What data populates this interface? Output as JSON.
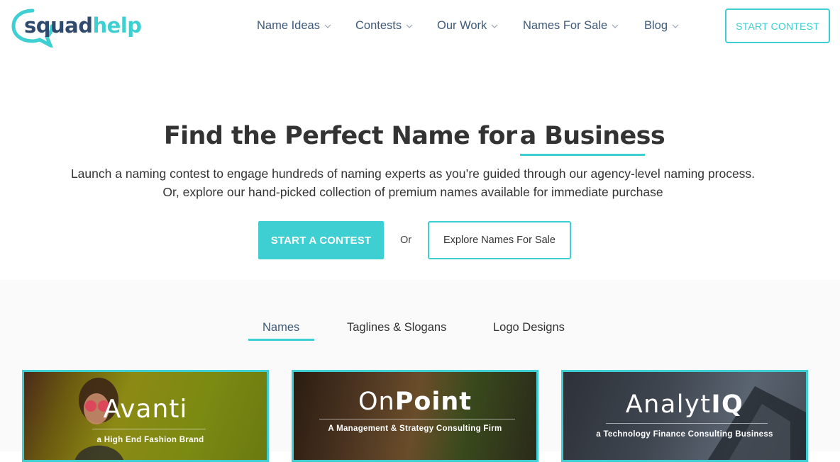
{
  "brand": {
    "part1": "squad",
    "part2": "help"
  },
  "nav": {
    "items": [
      {
        "label": "Name Ideas"
      },
      {
        "label": "Contests"
      },
      {
        "label": "Our Work"
      },
      {
        "label": "Names For Sale"
      },
      {
        "label": "Blog"
      }
    ],
    "cta_label": "START CONTEST"
  },
  "hero": {
    "title_regular": "Find the Perfect Name for",
    "title_bold": "a Business",
    "subtitle_line1": "Launch a naming contest to engage hundreds of naming experts as you’re guided through our agency-level naming process.",
    "subtitle_line2": "Or, explore our hand-picked collection of premium names available for immediate purchase",
    "primary_button": "START A CONTEST",
    "or_text": "Or",
    "secondary_button": "Explore Names For Sale"
  },
  "gallery": {
    "tabs": [
      {
        "label": "Names",
        "active": true
      },
      {
        "label": "Taglines & Slogans",
        "active": false
      },
      {
        "label": "Logo Designs",
        "active": false
      }
    ],
    "cards": [
      {
        "name_regular": "Avanti",
        "name_bold": "",
        "tagline": "a High End Fashion Brand"
      },
      {
        "name_regular": "On",
        "name_bold": "Point",
        "tagline": "A Management & Strategy Consulting Firm"
      },
      {
        "name_regular": "Analyt",
        "name_bold": "IQ",
        "tagline": "a Technology Finance Consulting Business"
      }
    ]
  },
  "colors": {
    "accent": "#3ecfd2",
    "navy": "#2f4a6d",
    "nav_text": "#3e5a7a"
  },
  "icons": {
    "nav_dropdown": "chevron-down-icon",
    "logo": "speech-bubble-icon"
  }
}
